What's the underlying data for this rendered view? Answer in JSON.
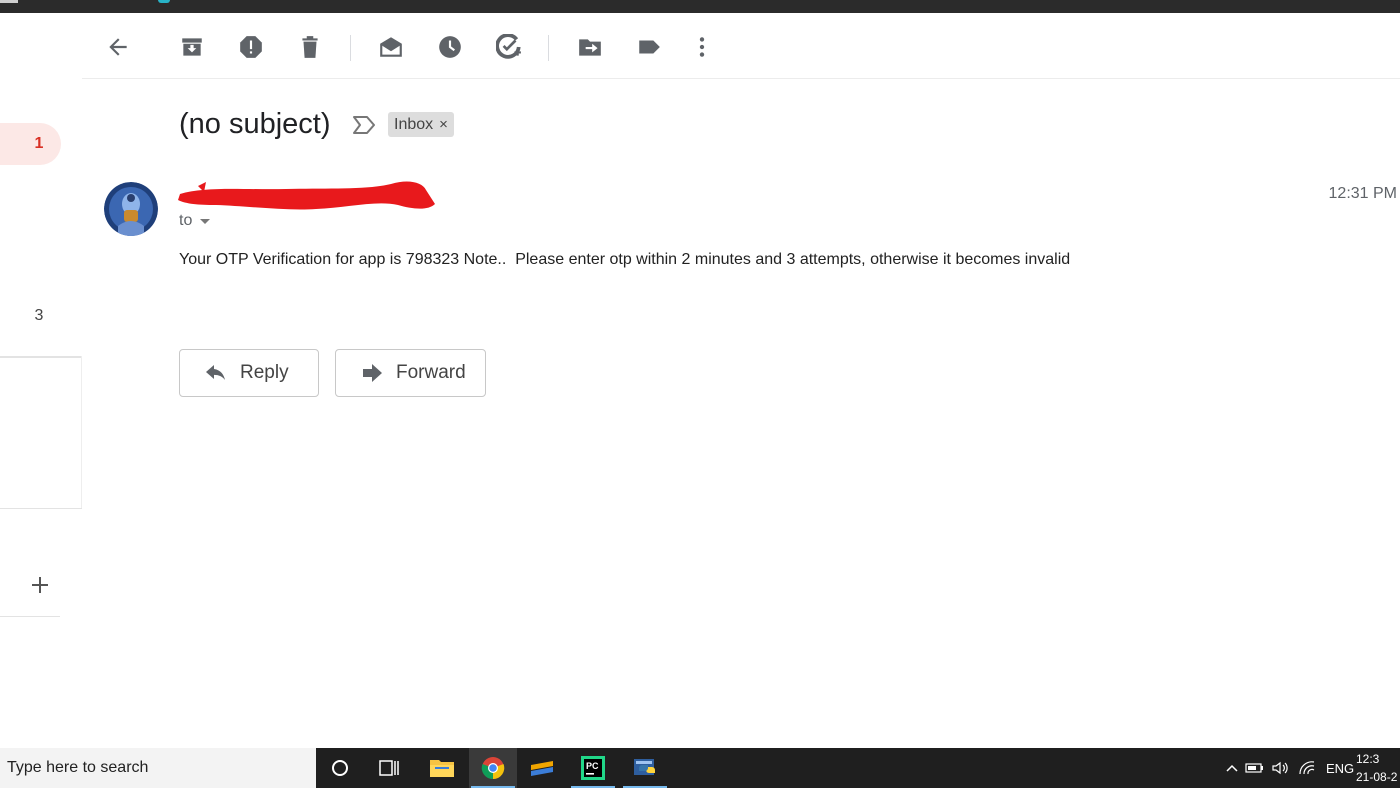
{
  "nav": {
    "badge_primary": "1",
    "badge_secondary": "3"
  },
  "toolbar": {
    "icons": [
      "back-arrow-icon",
      "archive-icon",
      "report-spam-icon",
      "delete-icon",
      "mark-unread-icon",
      "snooze-icon",
      "add-to-tasks-icon",
      "move-to-icon",
      "labels-icon",
      "more-vert-icon"
    ]
  },
  "email": {
    "subject": "(no subject)",
    "label": "Inbox",
    "label_remove": "×",
    "to": "to",
    "time": "12:31 PM",
    "body": "Your OTP Verification for app is 798323 Note..  Please enter otp within 2 minutes and 3 attempts, otherwise it becomes invalid"
  },
  "actions": {
    "reply": "Reply",
    "forward": "Forward"
  },
  "taskbar": {
    "search_placeholder": "Type here to search",
    "pycharm_label": "PC",
    "lang": "ENG",
    "clock_time": "12:3",
    "clock_date": "21-08-2"
  },
  "colors": {
    "unread_badge": "#d93025",
    "redaction": "#e8191c",
    "taskbar_accent": "#76b9ed"
  }
}
